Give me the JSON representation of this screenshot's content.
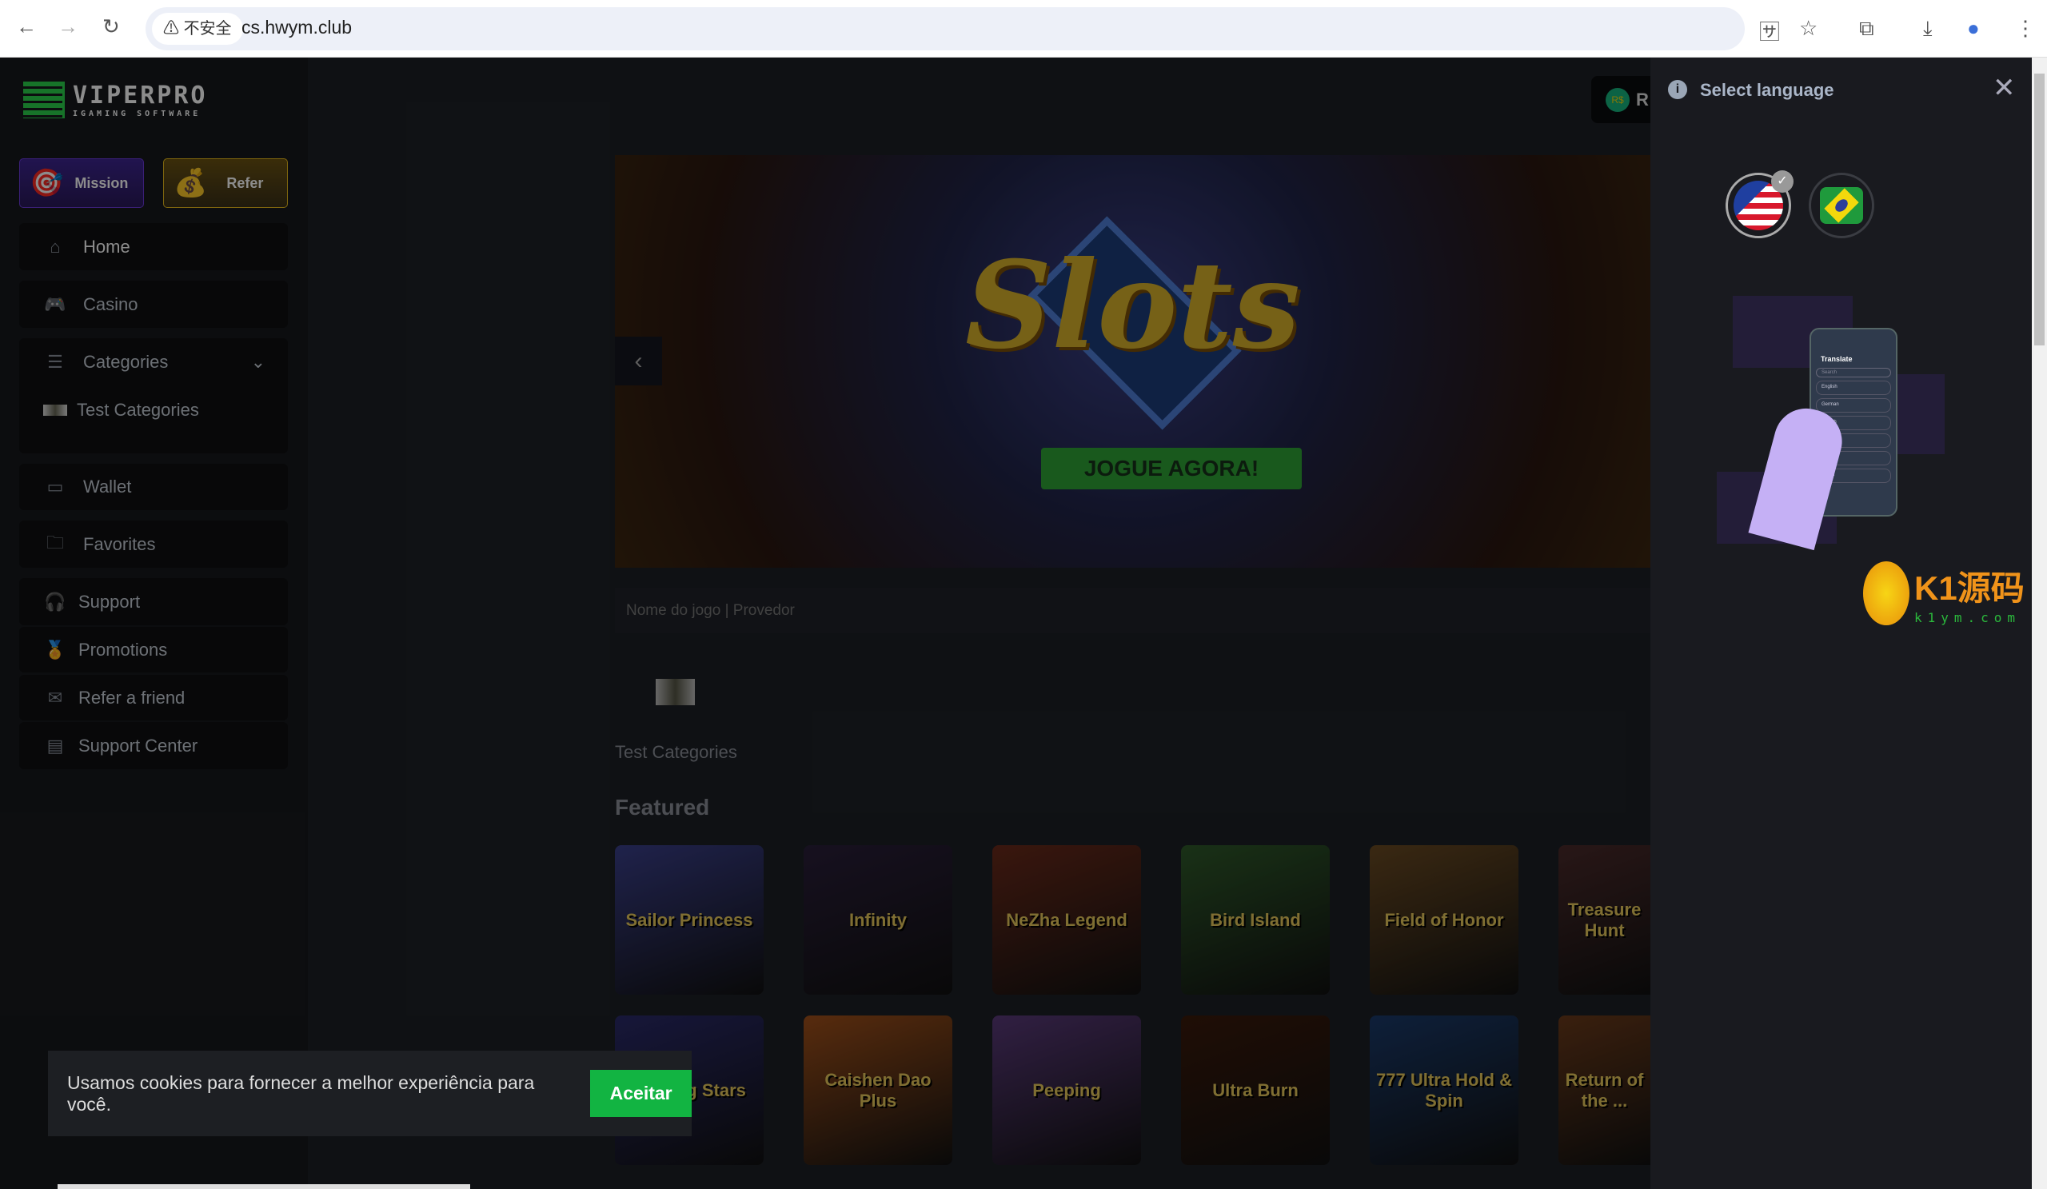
{
  "browser": {
    "security_label": "不安全",
    "url": "cs.hwym.club"
  },
  "logo": {
    "name": "VIPERPRO",
    "tagline": "IGAMING SOFTWARE"
  },
  "promo_buttons": [
    {
      "label": "Mission"
    },
    {
      "label": "Refer"
    }
  ],
  "sidebar": {
    "items": [
      {
        "label": "Home",
        "icon": "home-icon"
      },
      {
        "label": "Casino",
        "icon": "gamepad-icon"
      },
      {
        "label": "Categories",
        "icon": "list-icon"
      },
      {
        "label": "Test Categories",
        "icon": "category-thumbnail"
      },
      {
        "label": "Wallet",
        "icon": "wallet-icon"
      },
      {
        "label": "Favorites",
        "icon": "folder-star-icon"
      },
      {
        "label": "Support",
        "icon": "headset-icon"
      },
      {
        "label": "Promotions",
        "icon": "badge-icon"
      },
      {
        "label": "Refer a friend",
        "icon": "envelope-icon"
      },
      {
        "label": "Support Center",
        "icon": "support-center-icon"
      }
    ]
  },
  "header": {
    "currency_badge": "R$",
    "balance_prefix": "R"
  },
  "banner": {
    "title": "Slots",
    "cta": "JOGUE AGORA!",
    "slides": 4,
    "active_slide": 1
  },
  "search": {
    "placeholder": "Nome do jogo | Provedor"
  },
  "main": {
    "category_label": "Test Categories",
    "featured_title": "Featured",
    "games": [
      "Sailor Princess",
      "Infinity",
      "NeZha Legend",
      "Bird Island",
      "Field of Honor",
      "Treasure Hunt",
      "Shining Stars",
      "Caishen Dao Plus",
      "Peeping",
      "Ultra Burn",
      "777 Ultra Hold & Spin",
      "Return of the ..."
    ]
  },
  "cookie": {
    "text": "Usamos cookies para fornecer a melhor experiência para você.",
    "accept_label": "Aceitar"
  },
  "language_panel": {
    "title": "Select language",
    "languages": [
      {
        "code": "en-US",
        "selected": true
      },
      {
        "code": "pt-BR",
        "selected": false
      }
    ],
    "illustration": {
      "title": "Translate",
      "search": "Search",
      "items": [
        "English",
        "German",
        "French",
        "Italian",
        "",
        "Japan"
      ]
    }
  },
  "watermark": {
    "brand": "K1源码",
    "domain": "k1ym.com"
  },
  "colors": {
    "accent": "#12b442",
    "mission": "#4a2a9a",
    "refer": "#c79a1a",
    "panel": "#191a1f"
  }
}
